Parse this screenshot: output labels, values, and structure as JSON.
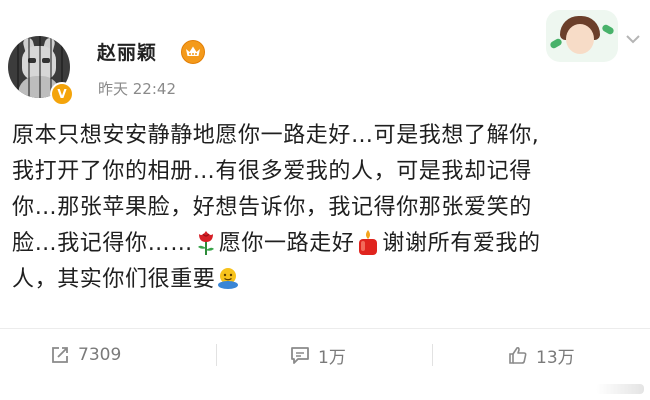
{
  "header": {
    "username": "赵丽颖",
    "timestamp": "昨天 22:42",
    "verified_badge": "V",
    "badge_icon": "crown-icon"
  },
  "post": {
    "lines": [
      "原本只想安安静静地愿你一路走好…可是我想了解你,",
      "我打开了你的相册…有很多爱我的人，可是我却记得",
      "你…那张苹果脸，好想告诉你，我记得你那张爱笑的",
      "脸…我记得你……",
      "人，其实你们很重要"
    ],
    "line4_part2": "愿你一路走好",
    "line4_part3": "谢谢所有爱我的",
    "emojis": [
      "rose-icon",
      "candle-icon",
      "hug-icon"
    ]
  },
  "actions": {
    "repost_count": "7309",
    "comment_count": "1万",
    "like_count": "13万"
  },
  "colors": {
    "text": "#1f1f1f",
    "muted": "#8a8a8a",
    "verified": "#f4a40b",
    "crown": "#f49a1b"
  }
}
